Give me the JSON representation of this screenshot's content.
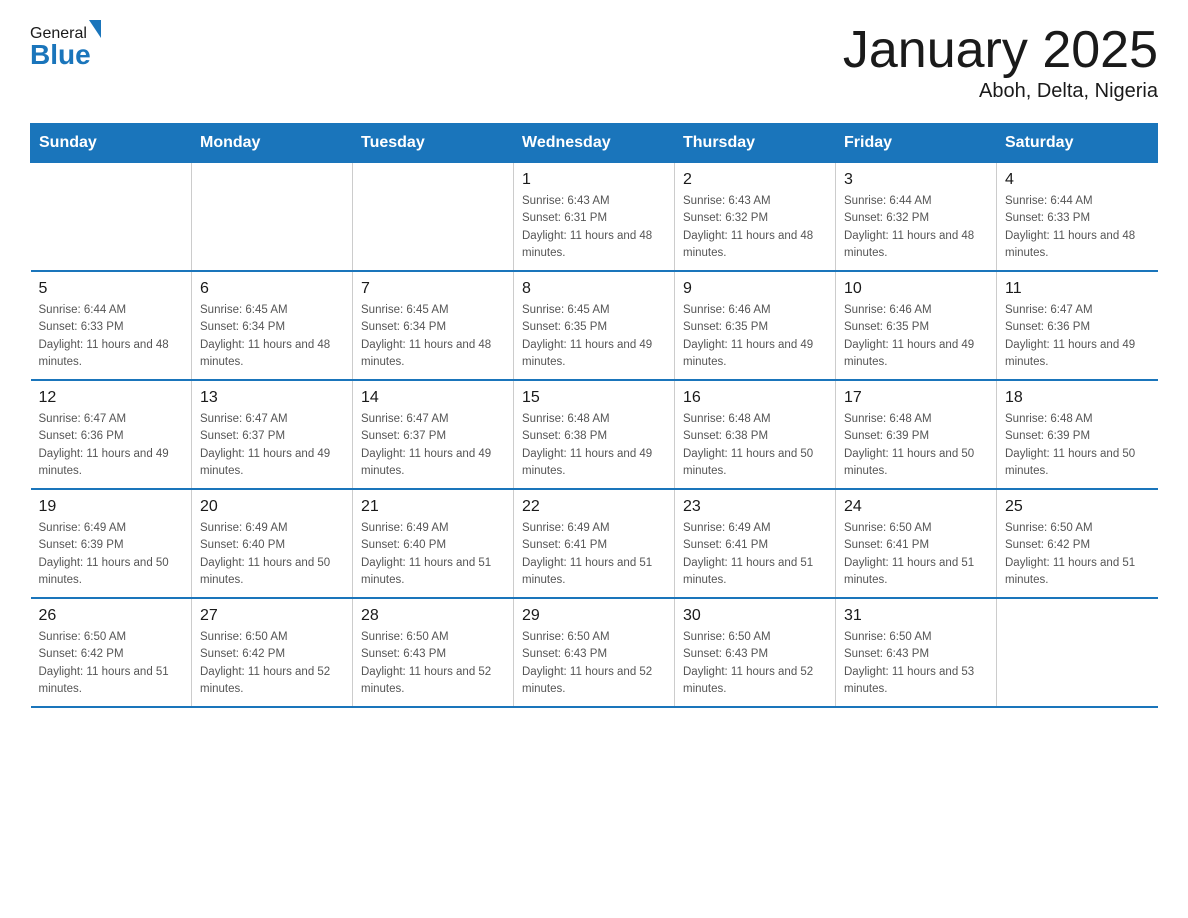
{
  "header": {
    "logo_general": "General",
    "logo_blue": "Blue",
    "title": "January 2025",
    "subtitle": "Aboh, Delta, Nigeria"
  },
  "days_of_week": [
    "Sunday",
    "Monday",
    "Tuesday",
    "Wednesday",
    "Thursday",
    "Friday",
    "Saturday"
  ],
  "weeks": [
    [
      {
        "day": "",
        "info": ""
      },
      {
        "day": "",
        "info": ""
      },
      {
        "day": "",
        "info": ""
      },
      {
        "day": "1",
        "info": "Sunrise: 6:43 AM\nSunset: 6:31 PM\nDaylight: 11 hours and 48 minutes."
      },
      {
        "day": "2",
        "info": "Sunrise: 6:43 AM\nSunset: 6:32 PM\nDaylight: 11 hours and 48 minutes."
      },
      {
        "day": "3",
        "info": "Sunrise: 6:44 AM\nSunset: 6:32 PM\nDaylight: 11 hours and 48 minutes."
      },
      {
        "day": "4",
        "info": "Sunrise: 6:44 AM\nSunset: 6:33 PM\nDaylight: 11 hours and 48 minutes."
      }
    ],
    [
      {
        "day": "5",
        "info": "Sunrise: 6:44 AM\nSunset: 6:33 PM\nDaylight: 11 hours and 48 minutes."
      },
      {
        "day": "6",
        "info": "Sunrise: 6:45 AM\nSunset: 6:34 PM\nDaylight: 11 hours and 48 minutes."
      },
      {
        "day": "7",
        "info": "Sunrise: 6:45 AM\nSunset: 6:34 PM\nDaylight: 11 hours and 48 minutes."
      },
      {
        "day": "8",
        "info": "Sunrise: 6:45 AM\nSunset: 6:35 PM\nDaylight: 11 hours and 49 minutes."
      },
      {
        "day": "9",
        "info": "Sunrise: 6:46 AM\nSunset: 6:35 PM\nDaylight: 11 hours and 49 minutes."
      },
      {
        "day": "10",
        "info": "Sunrise: 6:46 AM\nSunset: 6:35 PM\nDaylight: 11 hours and 49 minutes."
      },
      {
        "day": "11",
        "info": "Sunrise: 6:47 AM\nSunset: 6:36 PM\nDaylight: 11 hours and 49 minutes."
      }
    ],
    [
      {
        "day": "12",
        "info": "Sunrise: 6:47 AM\nSunset: 6:36 PM\nDaylight: 11 hours and 49 minutes."
      },
      {
        "day": "13",
        "info": "Sunrise: 6:47 AM\nSunset: 6:37 PM\nDaylight: 11 hours and 49 minutes."
      },
      {
        "day": "14",
        "info": "Sunrise: 6:47 AM\nSunset: 6:37 PM\nDaylight: 11 hours and 49 minutes."
      },
      {
        "day": "15",
        "info": "Sunrise: 6:48 AM\nSunset: 6:38 PM\nDaylight: 11 hours and 49 minutes."
      },
      {
        "day": "16",
        "info": "Sunrise: 6:48 AM\nSunset: 6:38 PM\nDaylight: 11 hours and 50 minutes."
      },
      {
        "day": "17",
        "info": "Sunrise: 6:48 AM\nSunset: 6:39 PM\nDaylight: 11 hours and 50 minutes."
      },
      {
        "day": "18",
        "info": "Sunrise: 6:48 AM\nSunset: 6:39 PM\nDaylight: 11 hours and 50 minutes."
      }
    ],
    [
      {
        "day": "19",
        "info": "Sunrise: 6:49 AM\nSunset: 6:39 PM\nDaylight: 11 hours and 50 minutes."
      },
      {
        "day": "20",
        "info": "Sunrise: 6:49 AM\nSunset: 6:40 PM\nDaylight: 11 hours and 50 minutes."
      },
      {
        "day": "21",
        "info": "Sunrise: 6:49 AM\nSunset: 6:40 PM\nDaylight: 11 hours and 51 minutes."
      },
      {
        "day": "22",
        "info": "Sunrise: 6:49 AM\nSunset: 6:41 PM\nDaylight: 11 hours and 51 minutes."
      },
      {
        "day": "23",
        "info": "Sunrise: 6:49 AM\nSunset: 6:41 PM\nDaylight: 11 hours and 51 minutes."
      },
      {
        "day": "24",
        "info": "Sunrise: 6:50 AM\nSunset: 6:41 PM\nDaylight: 11 hours and 51 minutes."
      },
      {
        "day": "25",
        "info": "Sunrise: 6:50 AM\nSunset: 6:42 PM\nDaylight: 11 hours and 51 minutes."
      }
    ],
    [
      {
        "day": "26",
        "info": "Sunrise: 6:50 AM\nSunset: 6:42 PM\nDaylight: 11 hours and 51 minutes."
      },
      {
        "day": "27",
        "info": "Sunrise: 6:50 AM\nSunset: 6:42 PM\nDaylight: 11 hours and 52 minutes."
      },
      {
        "day": "28",
        "info": "Sunrise: 6:50 AM\nSunset: 6:43 PM\nDaylight: 11 hours and 52 minutes."
      },
      {
        "day": "29",
        "info": "Sunrise: 6:50 AM\nSunset: 6:43 PM\nDaylight: 11 hours and 52 minutes."
      },
      {
        "day": "30",
        "info": "Sunrise: 6:50 AM\nSunset: 6:43 PM\nDaylight: 11 hours and 52 minutes."
      },
      {
        "day": "31",
        "info": "Sunrise: 6:50 AM\nSunset: 6:43 PM\nDaylight: 11 hours and 53 minutes."
      },
      {
        "day": "",
        "info": ""
      }
    ]
  ]
}
